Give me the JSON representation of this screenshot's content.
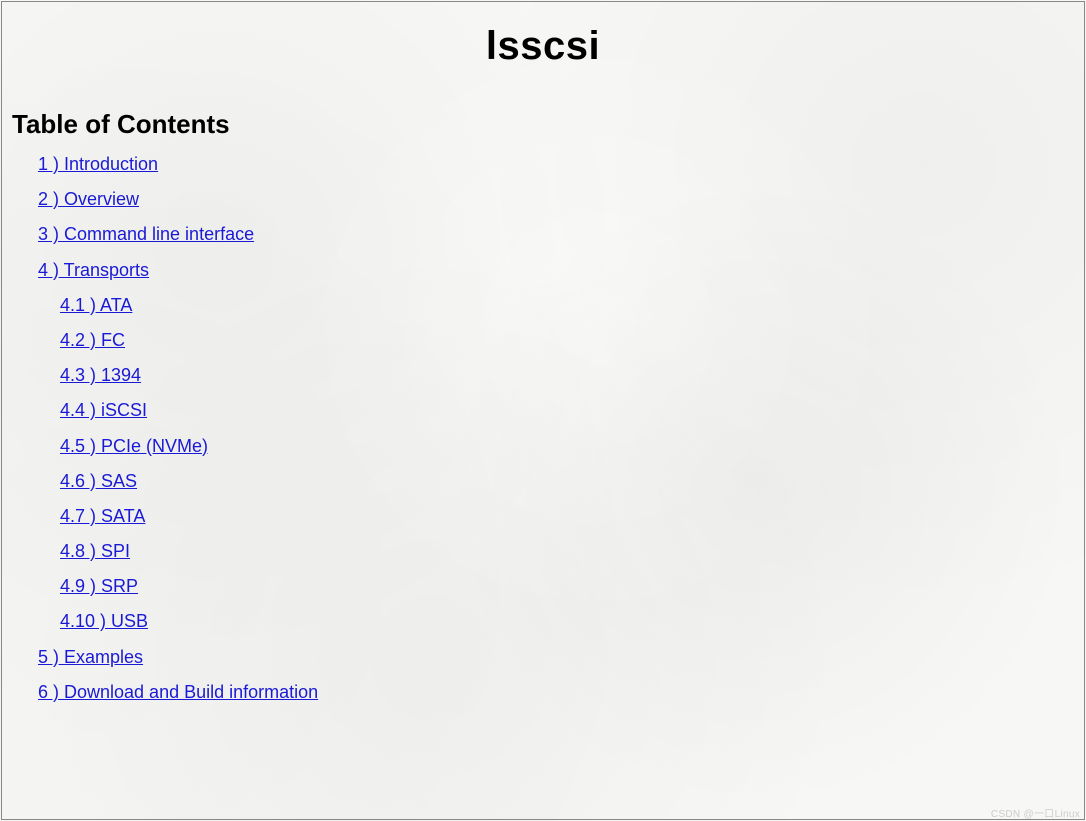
{
  "title": "lsscsi",
  "toc_heading": "Table of Contents",
  "toc": [
    {
      "label": "1 ) Introduction"
    },
    {
      "label": "2 ) Overview"
    },
    {
      "label": "3 ) Command line interface"
    },
    {
      "label": "4 ) Transports",
      "children": [
        {
          "label": "4.1 ) ATA"
        },
        {
          "label": "4.2 ) FC"
        },
        {
          "label": "4.3 ) 1394"
        },
        {
          "label": "4.4 ) iSCSI"
        },
        {
          "label": "4.5 ) PCIe (NVMe)"
        },
        {
          "label": "4.6 ) SAS"
        },
        {
          "label": "4.7 ) SATA"
        },
        {
          "label": "4.8 ) SPI"
        },
        {
          "label": "4.9 ) SRP"
        },
        {
          "label": "4.10 ) USB"
        }
      ]
    },
    {
      "label": "5 ) Examples"
    },
    {
      "label": "6 ) Download and Build information"
    }
  ],
  "watermark": "CSDN @一口Linux"
}
